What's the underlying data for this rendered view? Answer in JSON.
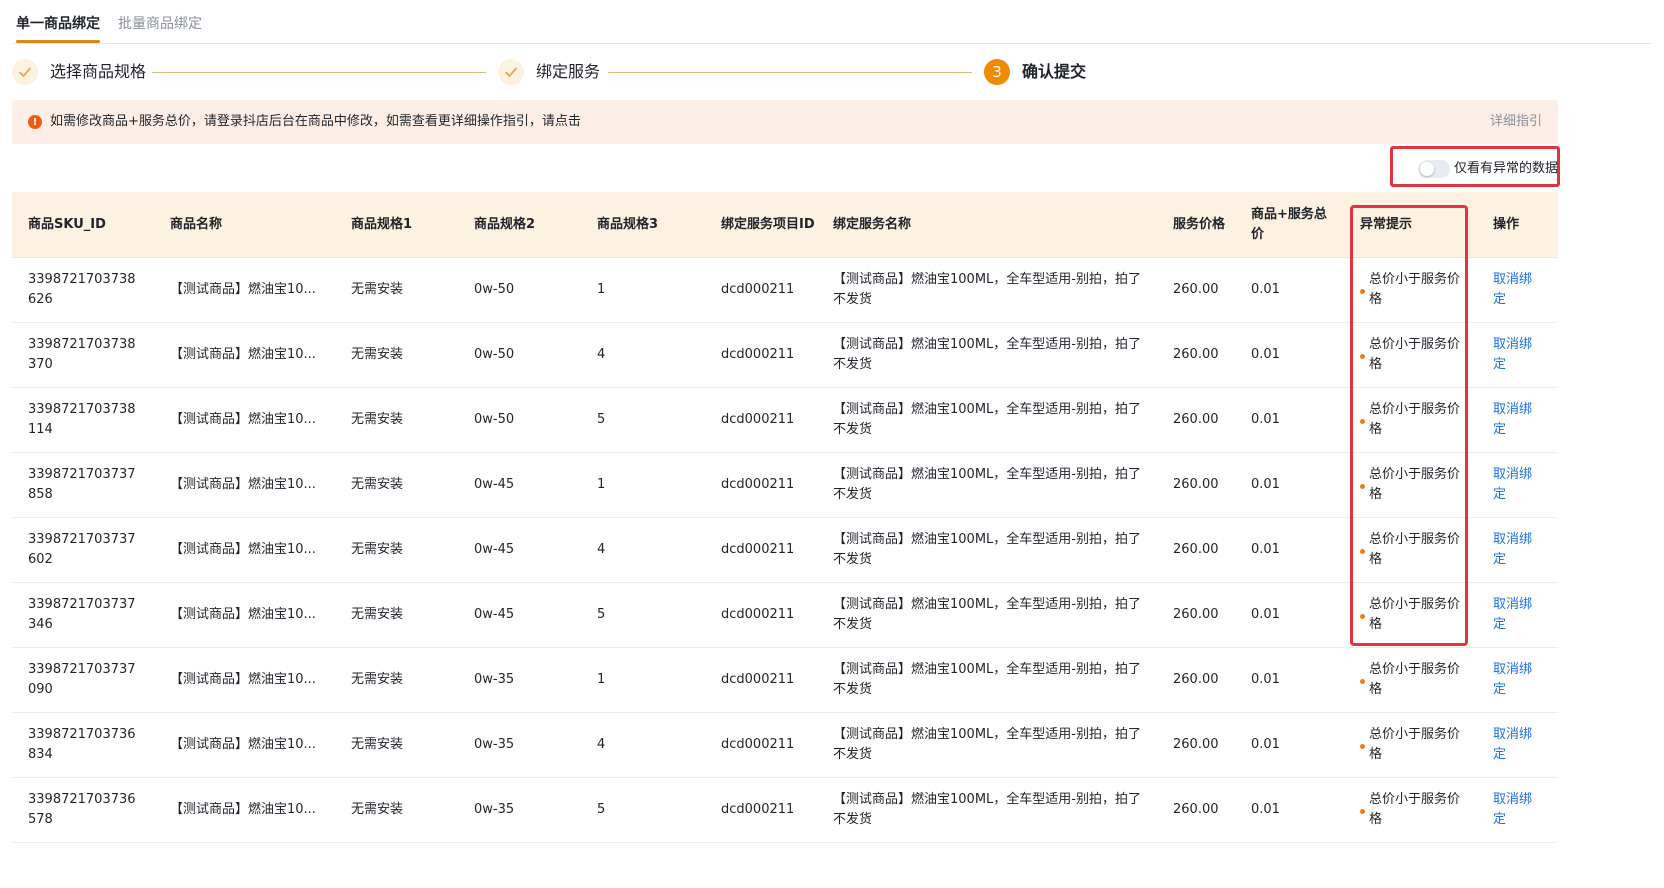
{
  "tabs": [
    {
      "label": "单一商品绑定",
      "active": true
    },
    {
      "label": "批量商品绑定",
      "active": false
    }
  ],
  "steps": [
    {
      "label": "选择商品规格",
      "status": "done"
    },
    {
      "label": "绑定服务",
      "status": "done"
    },
    {
      "label": "确认提交",
      "status": "current",
      "number": "3"
    }
  ],
  "alert": {
    "icon": "exclamation-icon",
    "text": "如需修改商品+服务总价，请登录抖店后台在商品中修改，如需查看更详细操作指引，请点击",
    "link": "详细指引"
  },
  "filter": {
    "label": "仅看有异常的数据",
    "on": false
  },
  "colors": {
    "accent": "#f08a00",
    "highlight": "#e0353e",
    "link": "#1e6fe0",
    "warn": "#ef7a1a"
  },
  "table": {
    "columns": {
      "sku": "商品SKU_ID",
      "name": "商品名称",
      "spec1": "商品规格1",
      "spec2": "商品规格2",
      "spec3": "商品规格3",
      "service_id": "绑定服务项目ID",
      "service_name": "绑定服务名称",
      "service_price": "服务价格",
      "total": "商品+服务总价",
      "warning": "异常提示",
      "action": "操作"
    },
    "rows": [
      {
        "sku": "3398721703738626",
        "name": "【测试商品】燃油宝10...",
        "spec1": "无需安装",
        "spec2": "0w-50",
        "spec3": "1",
        "service_id": "dcd000211",
        "service_name": "【测试商品】燃油宝100ML，全车型适用-别拍，拍了不发货",
        "service_price": "260.00",
        "total": "0.01",
        "warning": "总价小于服务价格",
        "action": "取消绑定"
      },
      {
        "sku": "3398721703738370",
        "name": "【测试商品】燃油宝10...",
        "spec1": "无需安装",
        "spec2": "0w-50",
        "spec3": "4",
        "service_id": "dcd000211",
        "service_name": "【测试商品】燃油宝100ML，全车型适用-别拍，拍了不发货",
        "service_price": "260.00",
        "total": "0.01",
        "warning": "总价小于服务价格",
        "action": "取消绑定"
      },
      {
        "sku": "3398721703738114",
        "name": "【测试商品】燃油宝10...",
        "spec1": "无需安装",
        "spec2": "0w-50",
        "spec3": "5",
        "service_id": "dcd000211",
        "service_name": "【测试商品】燃油宝100ML，全车型适用-别拍，拍了不发货",
        "service_price": "260.00",
        "total": "0.01",
        "warning": "总价小于服务价格",
        "action": "取消绑定"
      },
      {
        "sku": "3398721703737858",
        "name": "【测试商品】燃油宝10...",
        "spec1": "无需安装",
        "spec2": "0w-45",
        "spec3": "1",
        "service_id": "dcd000211",
        "service_name": "【测试商品】燃油宝100ML，全车型适用-别拍，拍了不发货",
        "service_price": "260.00",
        "total": "0.01",
        "warning": "总价小于服务价格",
        "action": "取消绑定"
      },
      {
        "sku": "3398721703737602",
        "name": "【测试商品】燃油宝10...",
        "spec1": "无需安装",
        "spec2": "0w-45",
        "spec3": "4",
        "service_id": "dcd000211",
        "service_name": "【测试商品】燃油宝100ML，全车型适用-别拍，拍了不发货",
        "service_price": "260.00",
        "total": "0.01",
        "warning": "总价小于服务价格",
        "action": "取消绑定"
      },
      {
        "sku": "3398721703737346",
        "name": "【测试商品】燃油宝10...",
        "spec1": "无需安装",
        "spec2": "0w-45",
        "spec3": "5",
        "service_id": "dcd000211",
        "service_name": "【测试商品】燃油宝100ML，全车型适用-别拍，拍了不发货",
        "service_price": "260.00",
        "total": "0.01",
        "warning": "总价小于服务价格",
        "action": "取消绑定"
      },
      {
        "sku": "3398721703737090",
        "name": "【测试商品】燃油宝10...",
        "spec1": "无需安装",
        "spec2": "0w-35",
        "spec3": "1",
        "service_id": "dcd000211",
        "service_name": "【测试商品】燃油宝100ML，全车型适用-别拍，拍了不发货",
        "service_price": "260.00",
        "total": "0.01",
        "warning": "总价小于服务价格",
        "action": "取消绑定"
      },
      {
        "sku": "3398721703736834",
        "name": "【测试商品】燃油宝10...",
        "spec1": "无需安装",
        "spec2": "0w-35",
        "spec3": "4",
        "service_id": "dcd000211",
        "service_name": "【测试商品】燃油宝100ML，全车型适用-别拍，拍了不发货",
        "service_price": "260.00",
        "total": "0.01",
        "warning": "总价小于服务价格",
        "action": "取消绑定"
      },
      {
        "sku": "3398721703736578",
        "name": "【测试商品】燃油宝10...",
        "spec1": "无需安装",
        "spec2": "0w-35",
        "spec3": "5",
        "service_id": "dcd000211",
        "service_name": "【测试商品】燃油宝100ML，全车型适用-别拍，拍了不发货",
        "service_price": "260.00",
        "total": "0.01",
        "warning": "总价小于服务价格",
        "action": "取消绑定"
      }
    ]
  }
}
